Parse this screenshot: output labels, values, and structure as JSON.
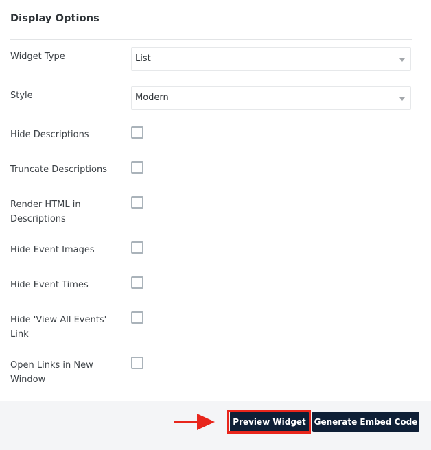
{
  "section": {
    "title": "Display Options"
  },
  "fields": {
    "widget_type": {
      "label": "Widget Type",
      "value": "List"
    },
    "style": {
      "label": "Style",
      "value": "Modern"
    }
  },
  "checkboxes": [
    {
      "label": "Hide Descriptions",
      "checked": false
    },
    {
      "label": "Truncate Descriptions",
      "checked": false
    },
    {
      "label": "Render HTML in Descriptions",
      "checked": false
    },
    {
      "label": "Hide Event Images",
      "checked": false
    },
    {
      "label": "Hide Event Times",
      "checked": false
    },
    {
      "label": "Hide 'View All Events' Link",
      "checked": false
    },
    {
      "label": "Open Links in New Window",
      "checked": false
    }
  ],
  "footer": {
    "preview_label": "Preview Widget",
    "embed_label": "Generate Embed Code"
  },
  "annotation": {
    "color": "#e8261c",
    "target": "Preview Widget"
  }
}
